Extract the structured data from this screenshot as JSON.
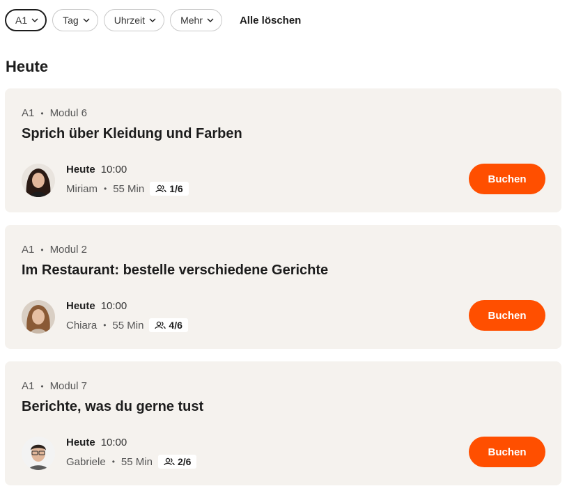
{
  "filters": {
    "chips": [
      {
        "label": "A1",
        "active": true
      },
      {
        "label": "Tag",
        "active": false
      },
      {
        "label": "Uhrzeit",
        "active": false
      },
      {
        "label": "Mehr",
        "active": false
      }
    ],
    "clear_all_label": "Alle löschen"
  },
  "section_title": "Heute",
  "accent_color": "#ff4f00",
  "classes": [
    {
      "level": "A1",
      "module": "Modul 6",
      "title": "Sprich über Kleidung und Farben",
      "day": "Heute",
      "time": "10:00",
      "teacher": "Miriam",
      "duration": "55 Min",
      "seats": "1/6",
      "book_label": "Buchen"
    },
    {
      "level": "A1",
      "module": "Modul 2",
      "title": "Im Restaurant: bestelle verschiedene Gerichte",
      "day": "Heute",
      "time": "10:00",
      "teacher": "Chiara",
      "duration": "55 Min",
      "seats": "4/6",
      "book_label": "Buchen"
    },
    {
      "level": "A1",
      "module": "Modul 7",
      "title": "Berichte, was du gerne tust",
      "day": "Heute",
      "time": "10:00",
      "teacher": "Gabriele",
      "duration": "55 Min",
      "seats": "2/6",
      "book_label": "Buchen"
    }
  ]
}
